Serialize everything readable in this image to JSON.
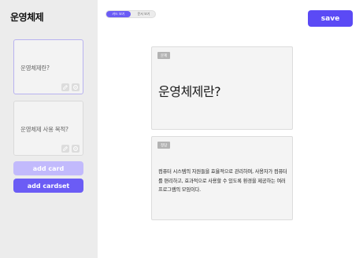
{
  "sidebar": {
    "title": "운영체제",
    "cards": [
      {
        "title": "운영체제란?",
        "icons": [
          "edit-icon",
          "gear-icon"
        ]
      },
      {
        "title": "운영체제 사용 목적?",
        "icons": [
          "edit-icon",
          "gear-icon"
        ]
      }
    ],
    "add_card_label": "add card",
    "add_cardset_label": "add cardset"
  },
  "toolbar": {
    "toggle_options": [
      "카드 보기",
      "문서 보기"
    ],
    "save_label": "save"
  },
  "editor": {
    "question_tag": "문제",
    "question_text": "운영체제란?",
    "answer_tag": "정답",
    "answer_text": "컴퓨터 시스템의 자원들을 효율적으로 관리하며, 사용자가 컴퓨터를 편리하고, 효과적으로 사용할 수 있도록 환경을 제공하는 여러 프로그램의 모임이다."
  },
  "colors": {
    "accent": "#6b5cf5",
    "save": "#5b4af5",
    "accent_light": "#c2bafc",
    "sidebar_bg": "#ececec"
  }
}
